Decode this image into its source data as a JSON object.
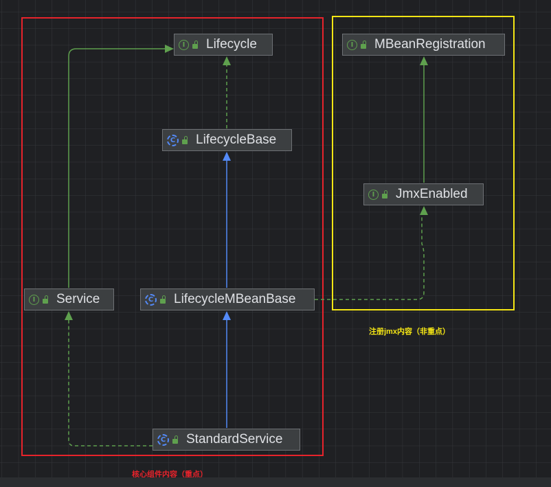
{
  "nodes": {
    "lifecycle": {
      "label": "Lifecycle",
      "kind": "interface"
    },
    "lifecycle_base": {
      "label": "LifecycleBase",
      "kind": "class"
    },
    "service": {
      "label": "Service",
      "kind": "interface"
    },
    "lifecycle_mbean_base": {
      "label": "LifecycleMBeanBase",
      "kind": "class"
    },
    "standard_service": {
      "label": "StandardService",
      "kind": "class"
    },
    "mbean_registration": {
      "label": "MBeanRegistration",
      "kind": "interface"
    },
    "jmx_enabled": {
      "label": "JmxEnabled",
      "kind": "interface"
    }
  },
  "groups": {
    "core": {
      "caption": "核心组件内容（重点）",
      "color": "#e8232b"
    },
    "jmx": {
      "caption": "注册jmx内容（非重点）",
      "color": "#f5e614"
    }
  },
  "colors": {
    "extends": "#548af7",
    "implements": "#5fa04e",
    "background": "#1f2023",
    "grid": "#35373b"
  }
}
